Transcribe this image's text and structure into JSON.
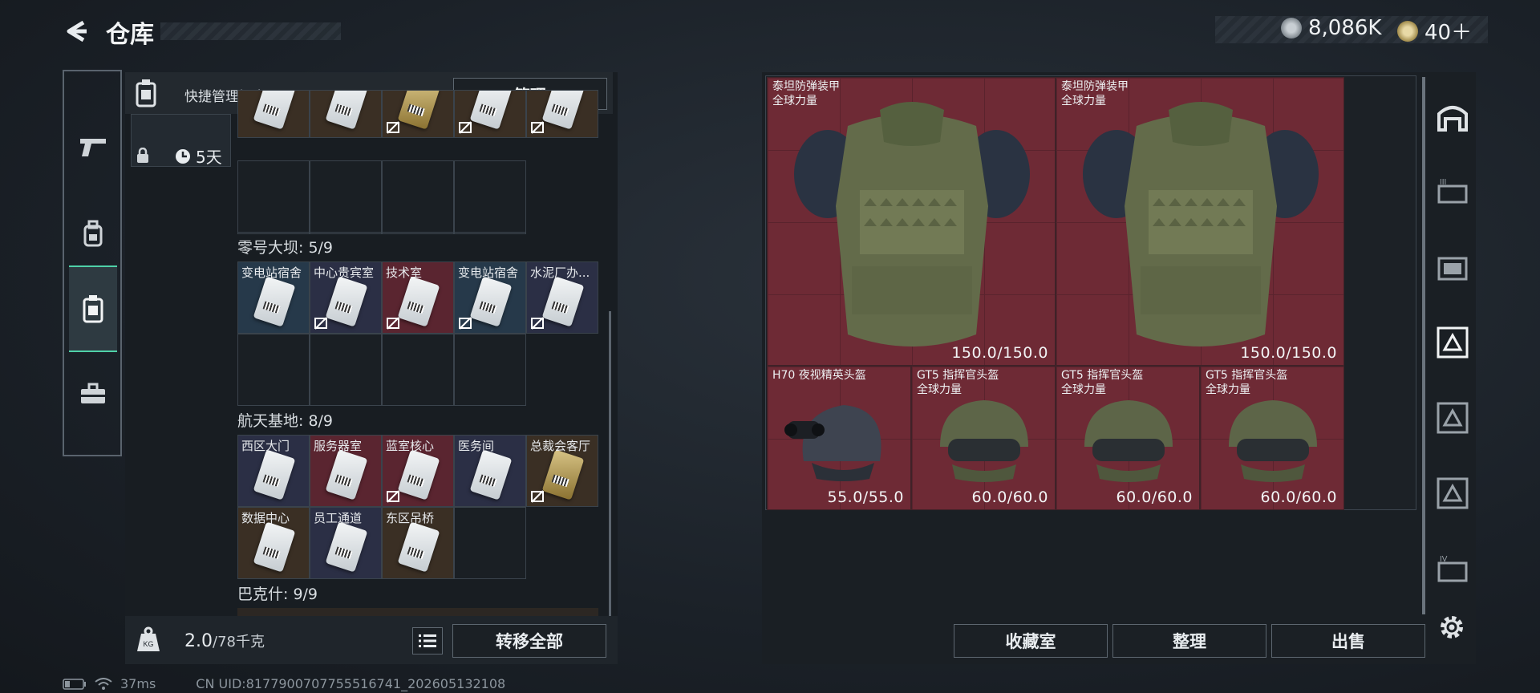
{
  "header": {
    "title": "仓库",
    "currency_1": "8,086K",
    "currency_2": "40＋"
  },
  "left": {
    "quick_bar_label": "快捷管理门卡",
    "manage_button": "管理",
    "timer_label": "5天",
    "regions": [
      {
        "title": "零号大坝: 5/9",
        "cards": [
          "变电站宿舍",
          "中心贵宾室",
          "技术室",
          "变电站宿舍",
          "水泥厂办..."
        ]
      },
      {
        "title": "航天基地: 8/9",
        "cards": [
          "西区大门",
          "服务器室",
          "蓝室核心",
          "医务间",
          "总裁会客厅",
          "数据中心",
          "员工通道",
          "东区吊桥"
        ]
      },
      {
        "title": "巴克什: 9/9",
        "cards": []
      }
    ],
    "weight_value": "2.0",
    "weight_max": "/78千克",
    "transfer_all_button": "转移全部"
  },
  "stash": {
    "items": [
      {
        "name_line1": "泰坦防弹装甲",
        "name_line2": "全球力量",
        "durability": "150.0/150.0"
      },
      {
        "name_line1": "泰坦防弹装甲",
        "name_line2": "全球力量",
        "durability": "150.0/150.0"
      },
      {
        "name_line1": "H70 夜视精英头盔",
        "name_line2": "",
        "durability": "55.0/55.0"
      },
      {
        "name_line1": "GT5 指挥官头盔",
        "name_line2": "全球力量",
        "durability": "60.0/60.0"
      },
      {
        "name_line1": "GT5 指挥官头盔",
        "name_line2": "全球力量",
        "durability": "60.0/60.0"
      },
      {
        "name_line1": "GT5 指挥官头盔",
        "name_line2": "全球力量",
        "durability": "60.0/60.0"
      }
    ]
  },
  "buttons": {
    "collection": "收藏室",
    "sort": "整理",
    "sell": "出售"
  },
  "status": {
    "ping": "37ms",
    "uid": "CN UID:8177900707755516741_202605132108"
  },
  "colors": {
    "accent": "#4fd1a8",
    "item_bg": "#6e2a35"
  }
}
